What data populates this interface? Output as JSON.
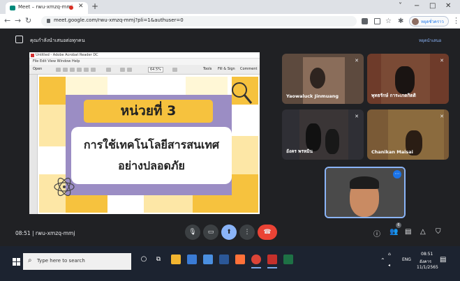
{
  "browser": {
    "tab_title": "Meet – rwu-xmzq-mmj",
    "new_tab": "+",
    "url": "meet.google.com/rwu-xmzq-mmj?pli=1&authuser=0",
    "profile_label": "หยุดชั่วคราว",
    "window_controls": [
      "˅",
      "−",
      "□",
      "✕"
    ]
  },
  "meet": {
    "presenting_text": "คุณกำลังนำเสนอต่อทุกคน",
    "stop_presenting": "หยุดนำเสนอ",
    "meeting_time": "08:51",
    "meeting_code": "rwu-xmzq-mmj",
    "participants": [
      {
        "name": "Yaowaluck Jinmuang",
        "bg": "#5d4a3e"
      },
      {
        "name": "พุทธรักษ์ การะเกดกิตติ",
        "bg": "#6e3b2a"
      },
      {
        "name": "อังคร พรหมิน",
        "bg": "#2f2f35"
      },
      {
        "name": "Chanikan Maisai",
        "bg": "#7a5a36"
      }
    ],
    "participant_count": "6"
  },
  "document": {
    "window_title": "Untitled - Adobe Acrobat Reader DC",
    "menu": "File  Edit  View  Window  Help",
    "open_label": "Open",
    "zoom": "64.5%",
    "tools_label": "Tools",
    "fill_sign_label": "Fill & Sign",
    "comment_label": "Comment",
    "slide_title": "หน่วยที่ 3",
    "slide_line1": "การใช้เทคโนโลยีสารสนเทศ",
    "slide_line2": "อย่างปลอดภัย"
  },
  "taskbar": {
    "search_placeholder": "Type here to search",
    "lang": "ENG",
    "time": "08:51",
    "day": "อังคาร",
    "date": "11/1/2565"
  }
}
